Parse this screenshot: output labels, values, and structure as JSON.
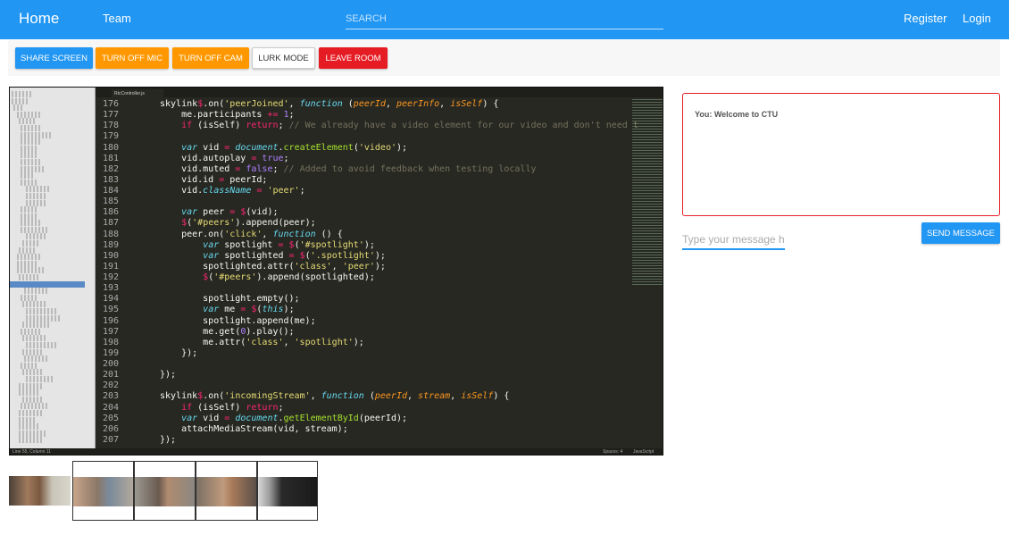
{
  "nav": {
    "home": "Home",
    "team": "Team",
    "search_placeholder": "SEARCH",
    "register": "Register",
    "login": "Login"
  },
  "toolbar": {
    "share_screen": "SHARE SCREEN",
    "turn_off_mic": "TURN OFF MIC",
    "turn_off_cam": "TURN OFF CAM",
    "lurk_mode": "LURK MODE",
    "leave_room": "LEAVE ROOM"
  },
  "shared_screen": {
    "tab_name": "RtcController.js",
    "status_left": "Line 55, Column 11",
    "status_spaces": "Spaces: 4",
    "status_lang": "JavaScript",
    "line_numbers": "176\n177\n178\n179\n180\n181\n182\n183\n184\n185\n186\n187\n188\n189\n190\n191\n192\n193\n194\n195\n196\n197\n198\n199\n200\n201\n202\n203\n204\n205\n206\n207"
  },
  "chat": {
    "messages": [
      {
        "sender": "You",
        "text": "Welcome to CTU",
        "display": "You: Welcome to CTU"
      }
    ],
    "input_placeholder": "Type your message her",
    "send_label": "SEND MESSAGE"
  },
  "colors": {
    "primary": "#2196f3",
    "warning": "#ff9800",
    "danger": "#e51c23"
  }
}
